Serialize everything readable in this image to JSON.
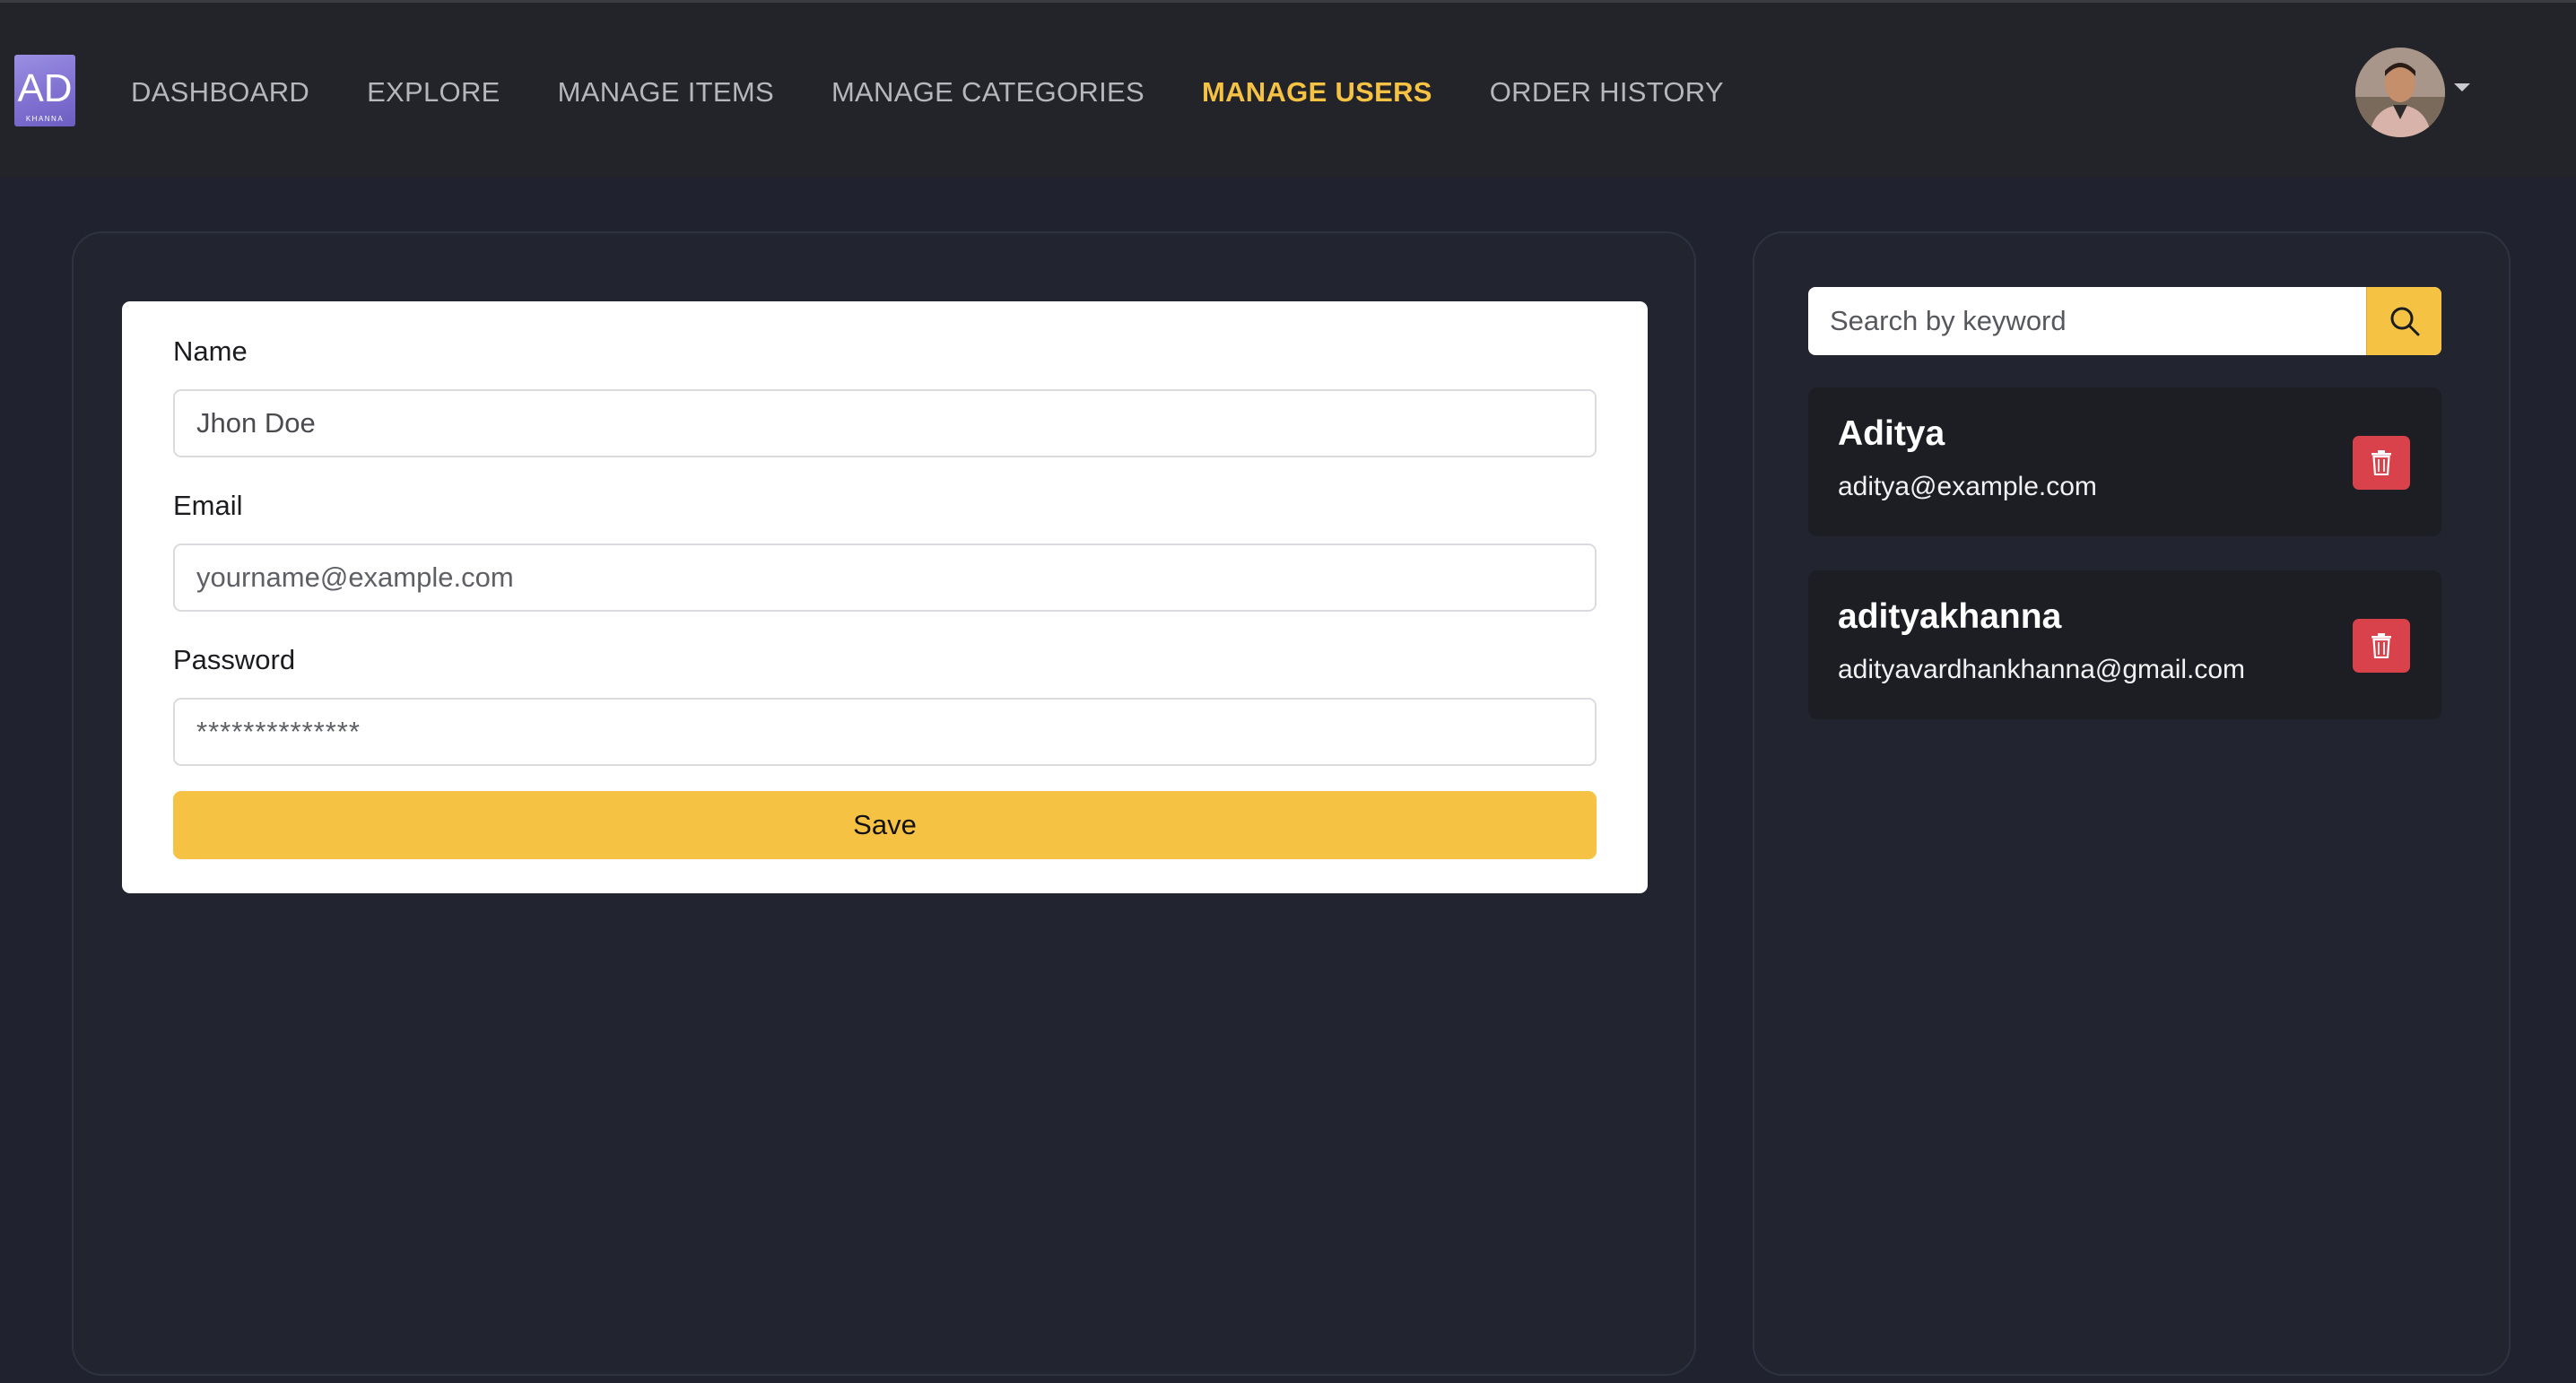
{
  "logo": {
    "letters": "AD",
    "subtext": "KHANNA",
    "color": "#8a7cd9"
  },
  "nav": {
    "items": [
      {
        "label": "DASHBOARD",
        "active": false
      },
      {
        "label": "EXPLORE",
        "active": false
      },
      {
        "label": "MANAGE ITEMS",
        "active": false
      },
      {
        "label": "MANAGE CATEGORIES",
        "active": false
      },
      {
        "label": "MANAGE USERS",
        "active": true
      },
      {
        "label": "ORDER HISTORY",
        "active": false
      }
    ],
    "active_color": "#f6c244",
    "profile_icon": "user-avatar",
    "caret_icon": "caret-down-icon"
  },
  "form": {
    "name_label": "Name",
    "name_value": "Jhon Doe",
    "email_label": "Email",
    "email_placeholder": "yourname@example.com",
    "password_label": "Password",
    "password_placeholder": "**************",
    "save_label": "Save",
    "save_color": "#f6c244"
  },
  "search": {
    "placeholder": "Search by keyword",
    "icon": "search-icon"
  },
  "users": [
    {
      "name": "Aditya",
      "email": "aditya@example.com",
      "delete_icon": "trash-icon"
    },
    {
      "name": "adityakhanna",
      "email": "adityavardhankhanna@gmail.com",
      "delete_icon": "trash-icon"
    }
  ],
  "colors": {
    "background": "#20222f",
    "danger": "#d9414b"
  }
}
